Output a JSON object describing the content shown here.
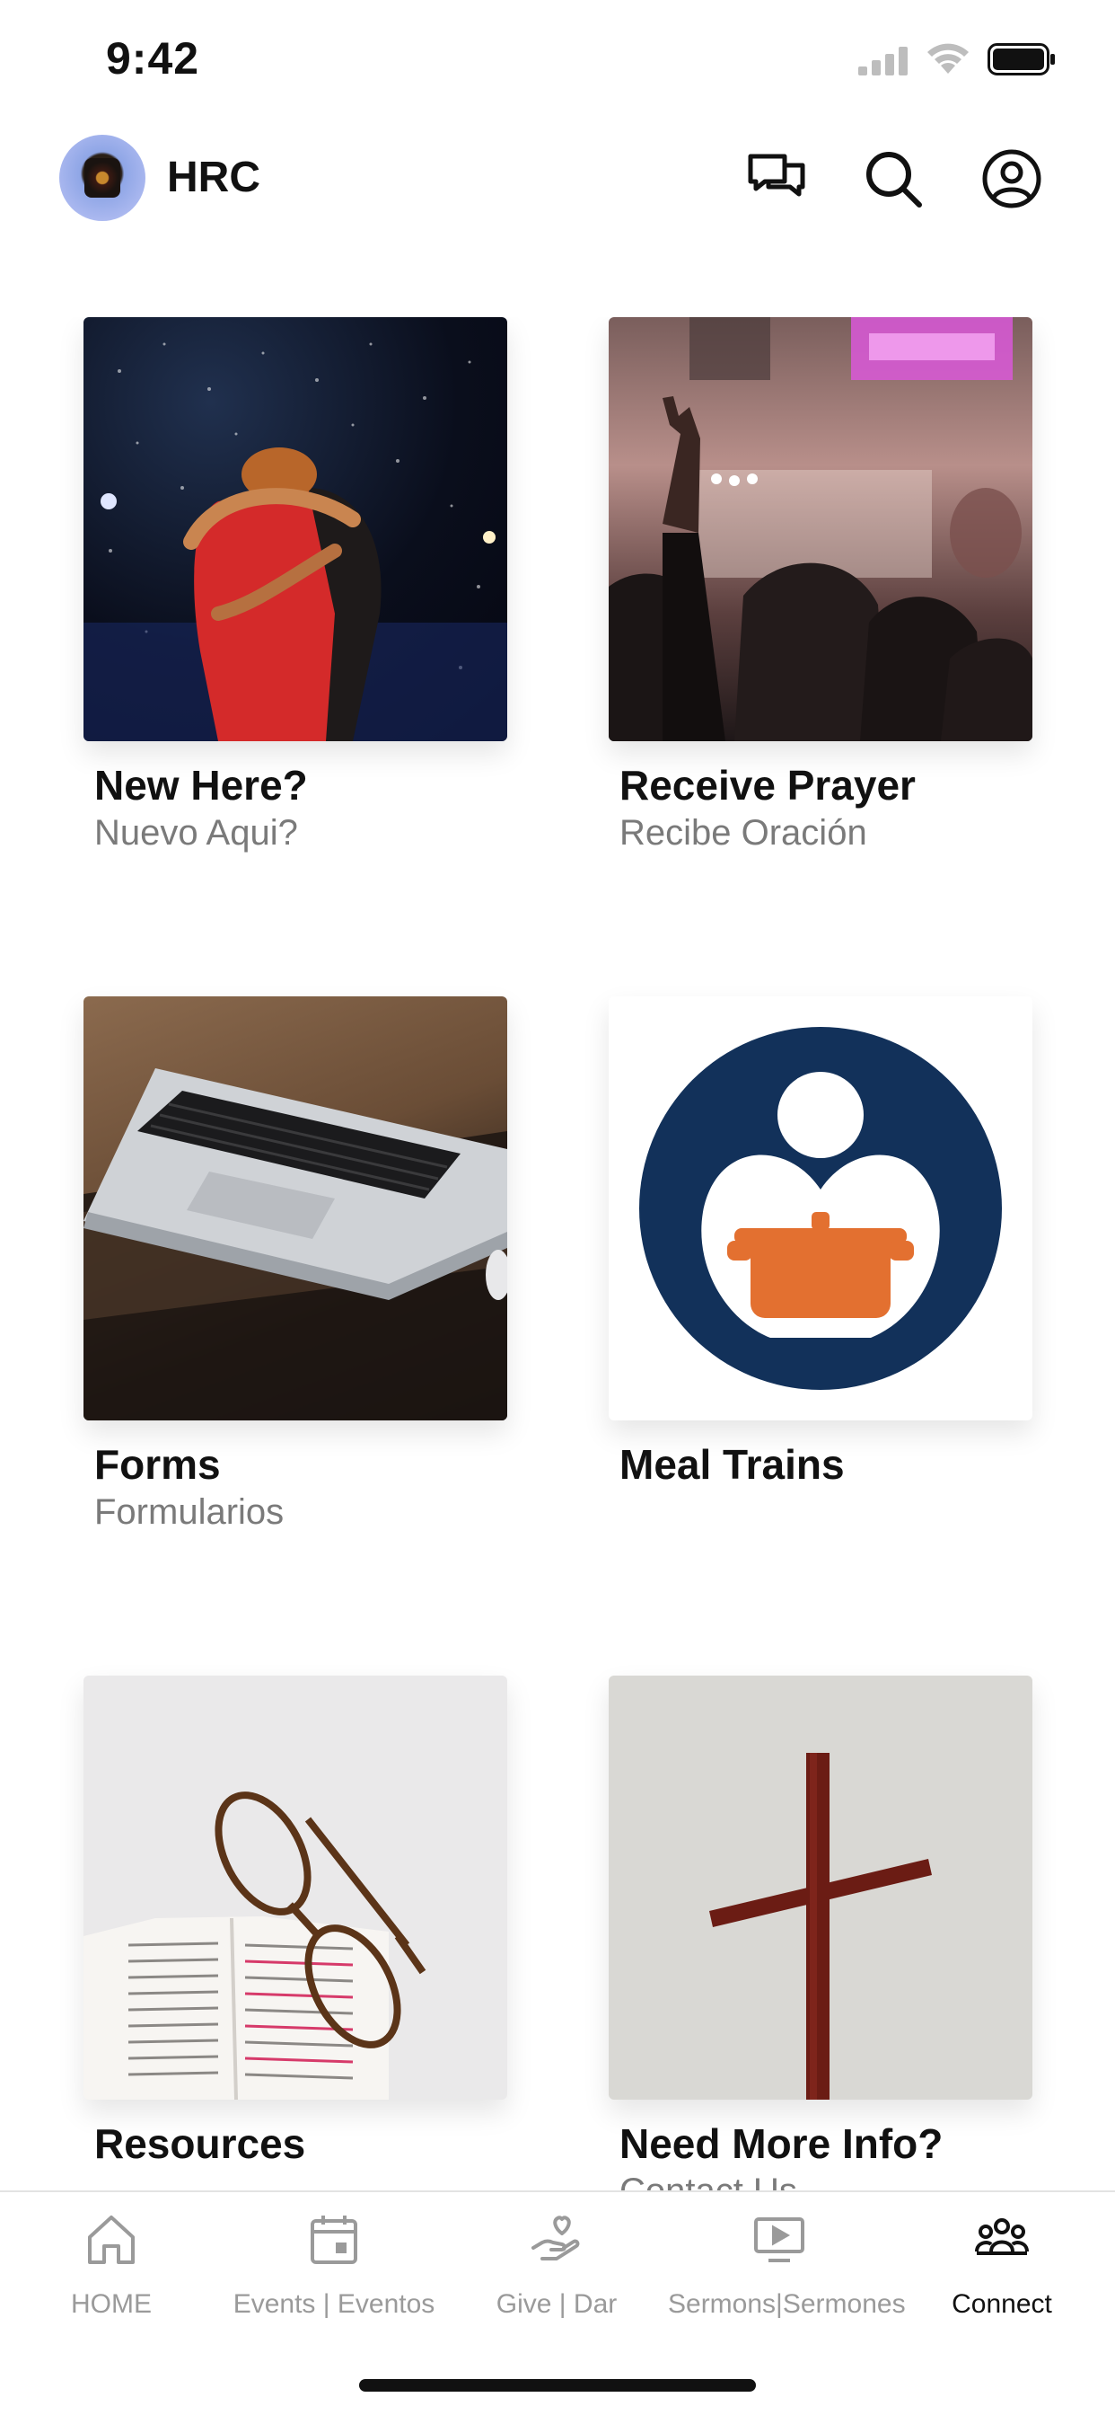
{
  "status_bar": {
    "time": "9:42"
  },
  "header": {
    "title": "HRC",
    "icons": [
      "chat-icon",
      "search-icon",
      "profile-icon"
    ]
  },
  "cards": [
    {
      "title": "New Here?",
      "subtitle": "Nuevo Aqui?",
      "image": "hug-photo"
    },
    {
      "title": "Receive Prayer",
      "subtitle": "Recibe Oración",
      "image": "worship-photo"
    },
    {
      "title": "Forms",
      "subtitle": "Formularios",
      "image": "laptop-photo"
    },
    {
      "title": "Meal Trains",
      "subtitle": "",
      "image": "meal-train-logo"
    },
    {
      "title": "Resources",
      "subtitle": "",
      "image": "bible-glasses-photo"
    },
    {
      "title": "Need More Info?",
      "subtitle": "Contact Us",
      "image": "cross-photo"
    }
  ],
  "tab_bar": {
    "tabs": [
      {
        "label": "HOME",
        "icon": "home-icon",
        "active": false
      },
      {
        "label": "Events | Eventos",
        "icon": "calendar-icon",
        "active": false
      },
      {
        "label": "Give | Dar",
        "icon": "give-icon",
        "active": false
      },
      {
        "label": "Sermons|Sermones",
        "icon": "video-icon",
        "active": false
      },
      {
        "label": "Connect",
        "icon": "people-icon",
        "active": true
      }
    ]
  },
  "colors": {
    "accent": "#111111",
    "inactive": "#9a9a9a",
    "meal_navy": "#12315a",
    "meal_orange": "#e37030"
  }
}
